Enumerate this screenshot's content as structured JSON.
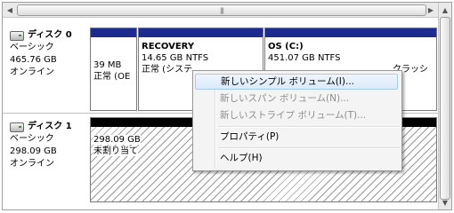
{
  "disks": [
    {
      "name": "ディスク 0",
      "type": "ベーシック",
      "size": "465.76 GB",
      "status": "オンライン",
      "partitions": [
        {
          "title": "",
          "line1": "39 MB",
          "line2": "正常 (OE"
        },
        {
          "title": "RECOVERY",
          "line1": "14.65 GB NTFS",
          "line2": "正常 (システ"
        },
        {
          "title": "OS  (C:)",
          "line1": "451.07 GB NTFS",
          "line2": "クラッシ"
        }
      ]
    },
    {
      "name": "ディスク 1",
      "type": "ベーシック",
      "size": "298.09 GB",
      "status": "オンライン",
      "partitions": [
        {
          "line1": "298.09 GB",
          "line2": "未割り当て"
        }
      ]
    }
  ],
  "scrollbar": {
    "thumb_grip": "|||"
  },
  "context_menu": {
    "items": [
      {
        "label": "新しいシンプル ボリューム(I)...",
        "enabled": true,
        "highlighted": true
      },
      {
        "label": "新しいスパン ボリューム(N)...",
        "enabled": false
      },
      {
        "label": "新しいストライプ ボリューム(T)...",
        "enabled": false
      },
      {
        "label": "プロパティ(P)",
        "enabled": true
      },
      {
        "label": "ヘルプ(H)",
        "enabled": true
      }
    ]
  },
  "colors": {
    "primary_partition_bar": "#1d2a8e",
    "unallocated_bar": "#000000",
    "menu_highlight": "#dbeafa"
  }
}
